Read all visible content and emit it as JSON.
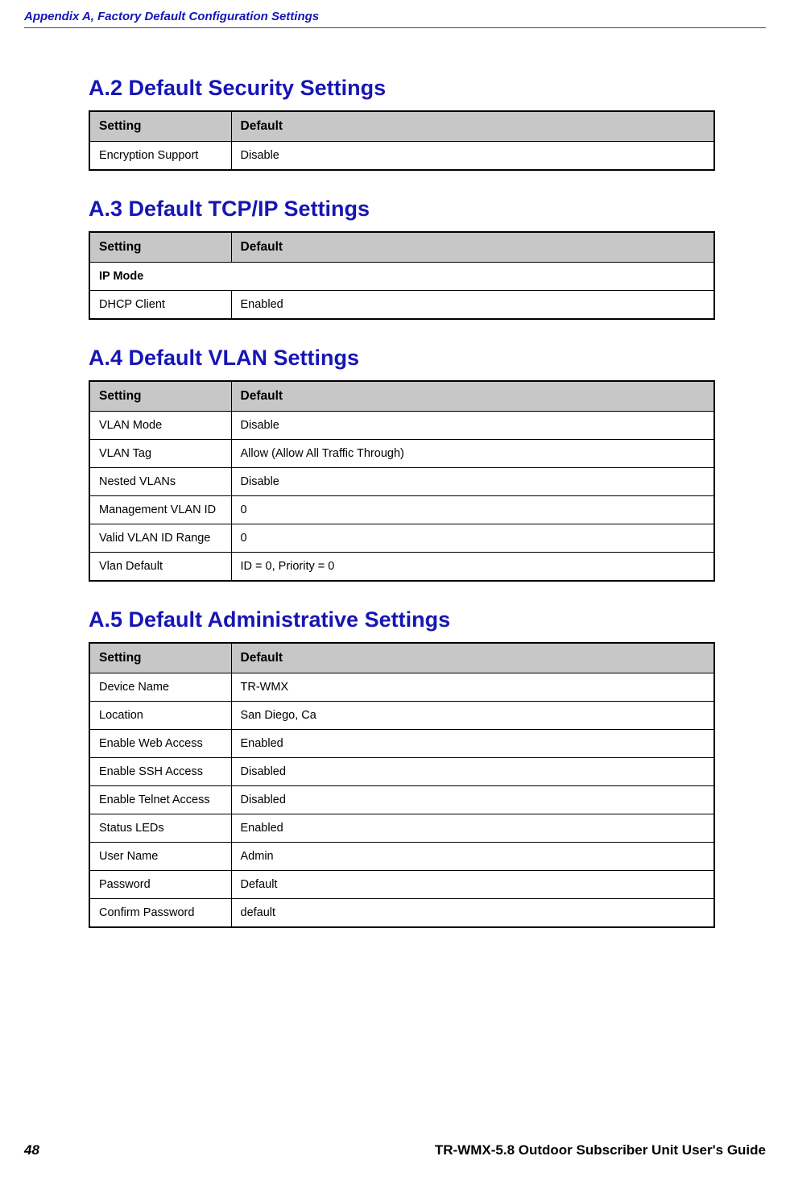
{
  "appendix_header": "Appendix A, Factory Default Configuration Settings",
  "sections": {
    "a2": {
      "heading": "A.2 Default Security Settings",
      "col1": "Setting",
      "col2": "Default",
      "rows": [
        {
          "setting": "Encryption Support",
          "default": "Disable"
        }
      ]
    },
    "a3": {
      "heading": "A.3 Default TCP/IP Settings",
      "col1": "Setting",
      "col2": "Default",
      "subheader": "IP Mode",
      "rows": [
        {
          "setting": "DHCP Client",
          "default": "Enabled"
        }
      ]
    },
    "a4": {
      "heading": "A.4 Default VLAN Settings",
      "col1": "Setting",
      "col2": "Default",
      "rows": [
        {
          "setting": "VLAN Mode",
          "default": "Disable"
        },
        {
          "setting": "VLAN Tag",
          "default": "Allow (Allow All Traffic Through)"
        },
        {
          "setting": "Nested VLANs",
          "default": "Disable"
        },
        {
          "setting": "Management VLAN ID",
          "default": "0"
        },
        {
          "setting": "Valid VLAN ID Range",
          "default": "0"
        },
        {
          "setting": "Vlan Default",
          "default": "ID = 0, Priority = 0"
        }
      ]
    },
    "a5": {
      "heading": "A.5 Default Administrative Settings",
      "col1": "Setting",
      "col2": "Default",
      "rows": [
        {
          "setting": "Device Name",
          "default": "TR-WMX"
        },
        {
          "setting": "Location",
          "default": "San Diego, Ca"
        },
        {
          "setting": "Enable Web Access",
          "default": "Enabled"
        },
        {
          "setting": "Enable SSH Access",
          "default": "Disabled"
        },
        {
          "setting": "Enable Telnet Access",
          "default": "Disabled"
        },
        {
          "setting": "Status LEDs",
          "default": "Enabled"
        },
        {
          "setting": "User Name",
          "default": "Admin"
        },
        {
          "setting": "Password",
          "default": "Default"
        },
        {
          "setting": "Confirm Password",
          "default": "default"
        }
      ]
    }
  },
  "footer": {
    "page_number": "48",
    "doc_title": "TR-WMX-5.8 Outdoor Subscriber Unit User's Guide"
  }
}
